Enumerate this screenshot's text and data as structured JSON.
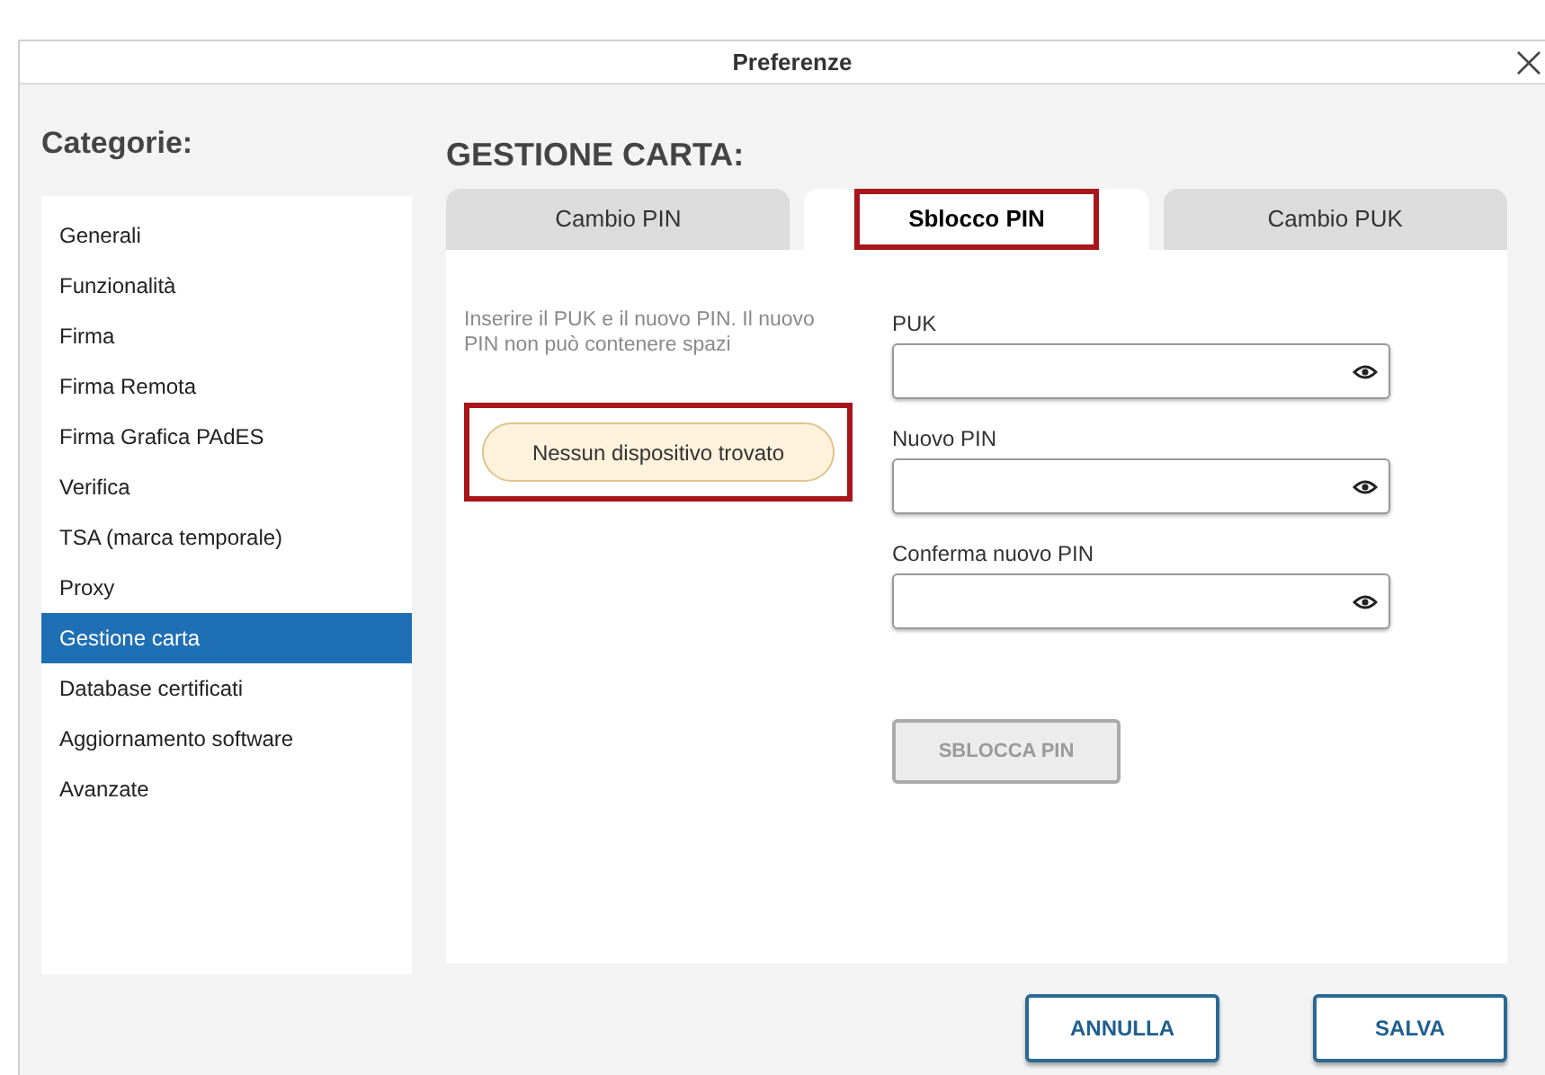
{
  "window": {
    "title": "Preferenze"
  },
  "sidebar": {
    "heading": "Categorie:",
    "items": [
      {
        "label": "Generali",
        "selected": false
      },
      {
        "label": "Funzionalità",
        "selected": false
      },
      {
        "label": "Firma",
        "selected": false
      },
      {
        "label": "Firma Remota",
        "selected": false
      },
      {
        "label": "Firma Grafica PAdES",
        "selected": false
      },
      {
        "label": "Verifica",
        "selected": false
      },
      {
        "label": "TSA (marca temporale)",
        "selected": false
      },
      {
        "label": "Proxy",
        "selected": false
      },
      {
        "label": "Gestione carta",
        "selected": true
      },
      {
        "label": "Database certificati",
        "selected": false
      },
      {
        "label": "Aggiornamento software",
        "selected": false
      },
      {
        "label": "Avanzate",
        "selected": false
      }
    ]
  },
  "section_title": "GESTIONE CARTA:",
  "tabs": [
    {
      "label": "Cambio PIN",
      "selected": false,
      "highlighted": false
    },
    {
      "label": "Sblocco PIN",
      "selected": true,
      "highlighted": true
    },
    {
      "label": "Cambio PUK",
      "selected": false,
      "highlighted": false
    }
  ],
  "instructions": "Inserire il PUK e il nuovo PIN. Il nuovo PIN non può contenere spazi",
  "notice": {
    "text": "Nessun dispositivo trovato",
    "highlighted": true
  },
  "fields": [
    {
      "label": "PUK"
    },
    {
      "label": "Nuovo PIN"
    },
    {
      "label": "Conferma nuovo PIN"
    }
  ],
  "unlock_button": {
    "label": "SBLOCCA PIN",
    "disabled": true
  },
  "buttons": [
    "ANNULLA",
    "SALVA"
  ]
}
